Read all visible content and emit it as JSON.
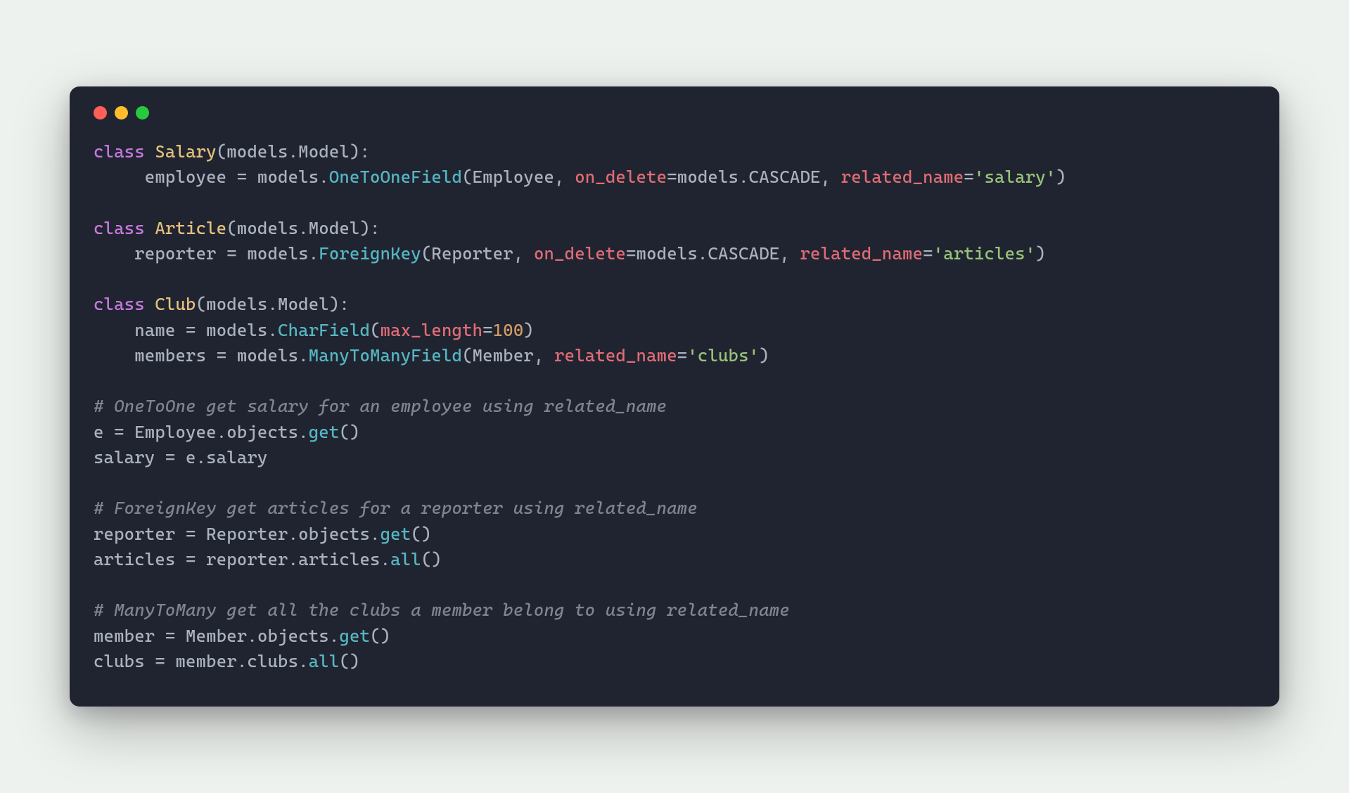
{
  "colors": {
    "bg_page": "#eef2ef",
    "bg_window": "#1f2430",
    "dot_red": "#ff5f56",
    "dot_yellow": "#ffbd2e",
    "dot_green": "#27c93f",
    "keyword": "#c678dd",
    "class": "#e5c07b",
    "function": "#56b6c2",
    "param": "#e06c75",
    "plain": "#abb2bf",
    "number": "#d19a66",
    "string": "#98c379",
    "comment": "#7f848e"
  },
  "tokens": {
    "kw_class": "class",
    "cls_salary": "Salary",
    "cls_article": "Article",
    "cls_club": "Club",
    "cls_employee": "Employee",
    "cls_reporter": "Reporter",
    "cls_member": "Member",
    "mod_models": "models",
    "attr_model": "Model",
    "fld_employee": "employee",
    "fld_reporter": "reporter",
    "fld_name": "name",
    "fld_members": "members",
    "fn_one2one": "OneToOneField",
    "fn_fk": "ForeignKey",
    "fn_char": "CharField",
    "fn_m2m": "ManyToManyField",
    "fn_get": "get",
    "fn_all": "all",
    "par_on_delete": "on_delete",
    "par_related_name": "related_name",
    "par_max_length": "max_length",
    "attr_cascade": "CASCADE",
    "attr_objects": "objects",
    "str_salary": "'salary'",
    "str_articles": "'articles'",
    "str_clubs": "'clubs'",
    "num_100": "100",
    "cmt_one2one": "# OneToOne get salary for an employee using related_name",
    "cmt_fk": "# ForeignKey get articles for a reporter using related_name",
    "cmt_m2m": "# ManyToMany get all the clubs a member belong to using related_name",
    "var_e": "e",
    "var_salary": "salary",
    "var_reporter": "reporter",
    "var_articles": "articles",
    "var_member": "member",
    "var_clubs": "clubs",
    "attr_salary": "salary",
    "attr_articles": "articles",
    "attr_clubs": "clubs",
    "op_eq": "=",
    "op_dot": ".",
    "op_lparen": "(",
    "op_rparen": ")",
    "op_colon": ":",
    "op_comma": ","
  }
}
